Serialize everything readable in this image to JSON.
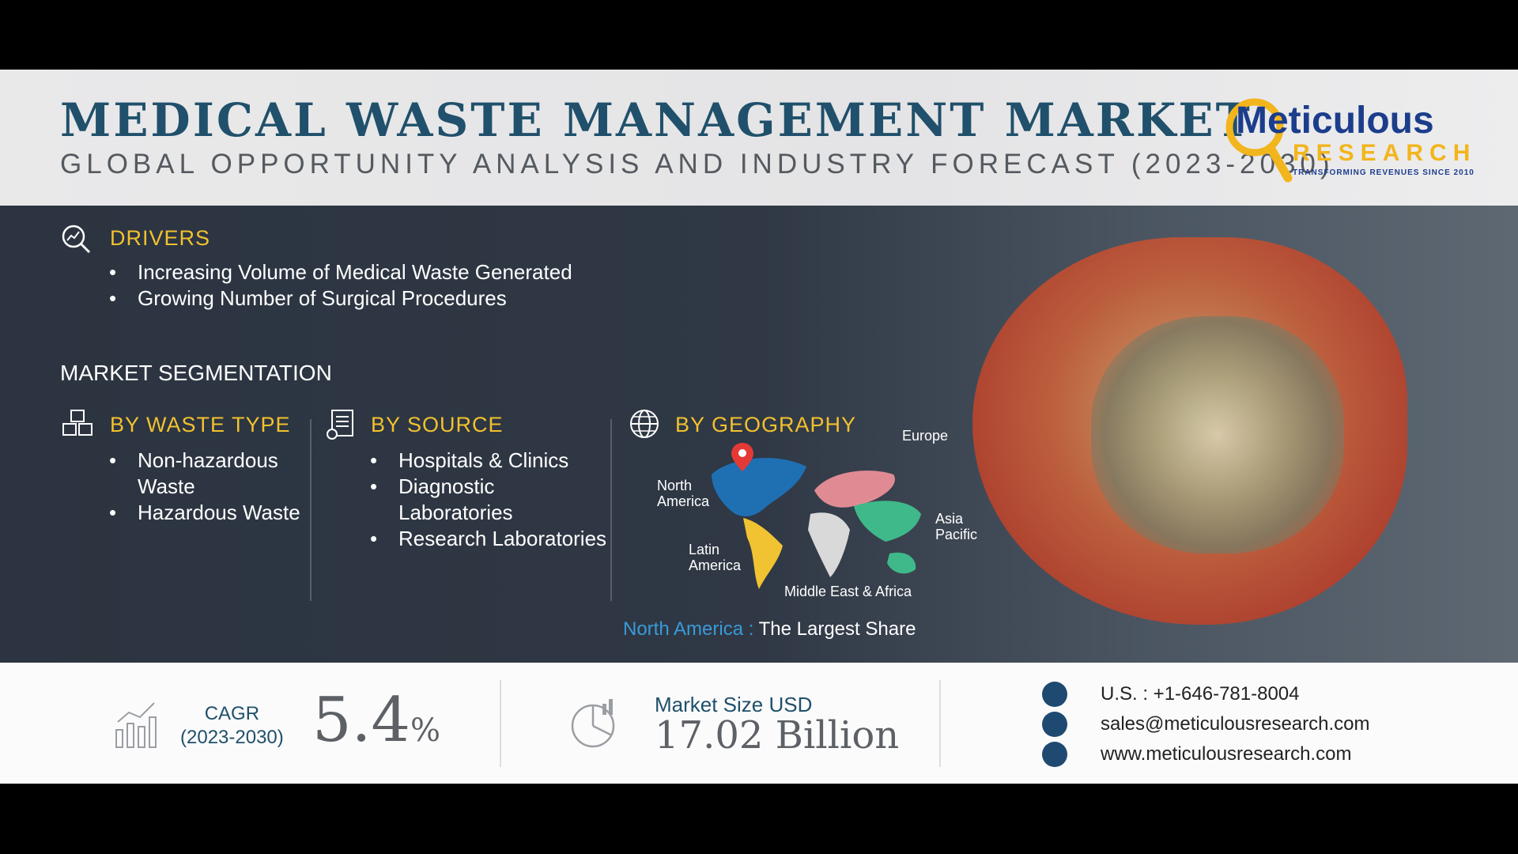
{
  "header": {
    "title": "MEDICAL WASTE MANAGEMENT MARKET",
    "subtitle": "GLOBAL OPPORTUNITY ANALYSIS AND INDUSTRY FORECAST (2023-2030)"
  },
  "logo": {
    "word": "Meticulous",
    "research": "RESEARCH",
    "tagline": "TRANSFORMING REVENUES SINCE 2010"
  },
  "drivers": {
    "label": "DRIVERS",
    "items": [
      "Increasing Volume of Medical Waste Generated",
      "Growing Number of Surgical Procedures"
    ]
  },
  "segmentation": {
    "title": "MARKET SEGMENTATION",
    "waste_type": {
      "label": "BY WASTE TYPE",
      "items": [
        "Non-hazardous Waste",
        "Hazardous Waste"
      ]
    },
    "source": {
      "label": "BY SOURCE",
      "items": [
        "Hospitals & Clinics",
        "Diagnostic Laboratories",
        "Research Laboratories"
      ]
    },
    "geography": {
      "label": "BY GEOGRAPHY",
      "regions": {
        "north_america": "North America",
        "europe": "Europe",
        "asia_pacific": "Asia Pacific",
        "latin_america": "Latin America",
        "mea": "Middle East & Africa"
      },
      "share_region": "North America :",
      "share_text": "The Largest Share"
    }
  },
  "footer": {
    "cagr_label": "CAGR",
    "cagr_period": "(2023-2030)",
    "cagr_value": "5.4",
    "cagr_unit": "%",
    "market_size_label": "Market Size USD",
    "market_size_value": "17.02 Billion",
    "phone": "U.S. : +1-646-781-8004",
    "email": "sales@meticulousresearch.com",
    "website": "www.meticulousresearch.com"
  },
  "colors": {
    "title": "#20506b",
    "accent": "#f2c12e",
    "north_america": "#1f6fb3",
    "europe": "#e08b94",
    "asia_pacific": "#3fb98a",
    "latin_america": "#f1c232",
    "mea": "#d9d9d9",
    "share_region": "#3a9ad9"
  }
}
